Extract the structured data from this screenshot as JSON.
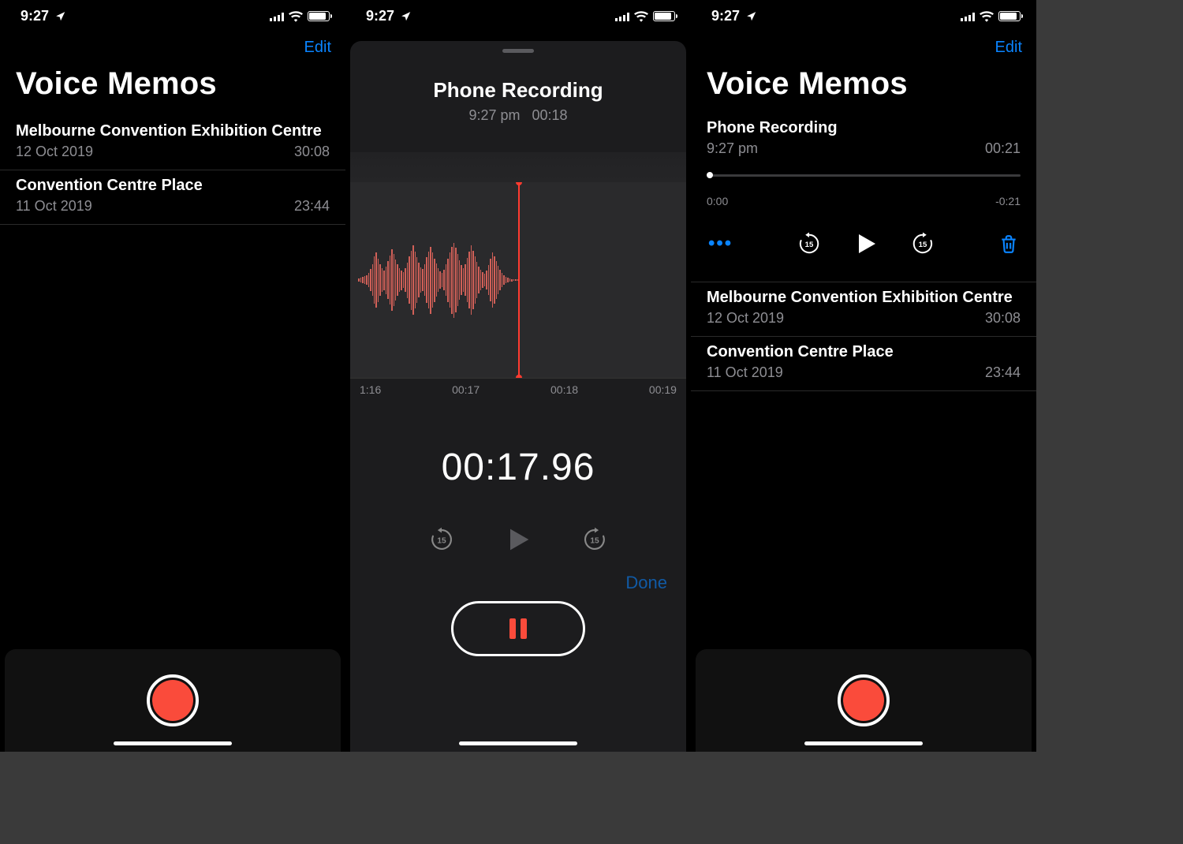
{
  "status": {
    "time": "9:27"
  },
  "colors": {
    "accent": "#0a84ff",
    "record": "#fa4b3b"
  },
  "screen1": {
    "edit_label": "Edit",
    "title": "Voice Memos",
    "memos": [
      {
        "title": "Melbourne Convention Exhibition Centre",
        "date": "12 Oct 2019",
        "duration": "30:08"
      },
      {
        "title": "Convention Centre Place",
        "date": "11 Oct 2019",
        "duration": "23:44"
      }
    ]
  },
  "screen2": {
    "title": "Phone Recording",
    "time_of_day": "9:27 pm",
    "elapsed_short": "00:18",
    "ticks": [
      "1:16",
      "00:17",
      "00:18",
      "00:19"
    ],
    "elapsed_precise": "00:17.96",
    "done_label": "Done"
  },
  "screen3": {
    "edit_label": "Edit",
    "title": "Voice Memos",
    "selected": {
      "title": "Phone Recording",
      "date": "9:27 pm",
      "duration": "00:21",
      "scrub_start": "0:00",
      "scrub_remaining": "-0:21"
    },
    "memos": [
      {
        "title": "Melbourne Convention Exhibition Centre",
        "date": "12 Oct 2019",
        "duration": "30:08"
      },
      {
        "title": "Convention Centre Place",
        "date": "11 Oct 2019",
        "duration": "23:44"
      }
    ]
  }
}
